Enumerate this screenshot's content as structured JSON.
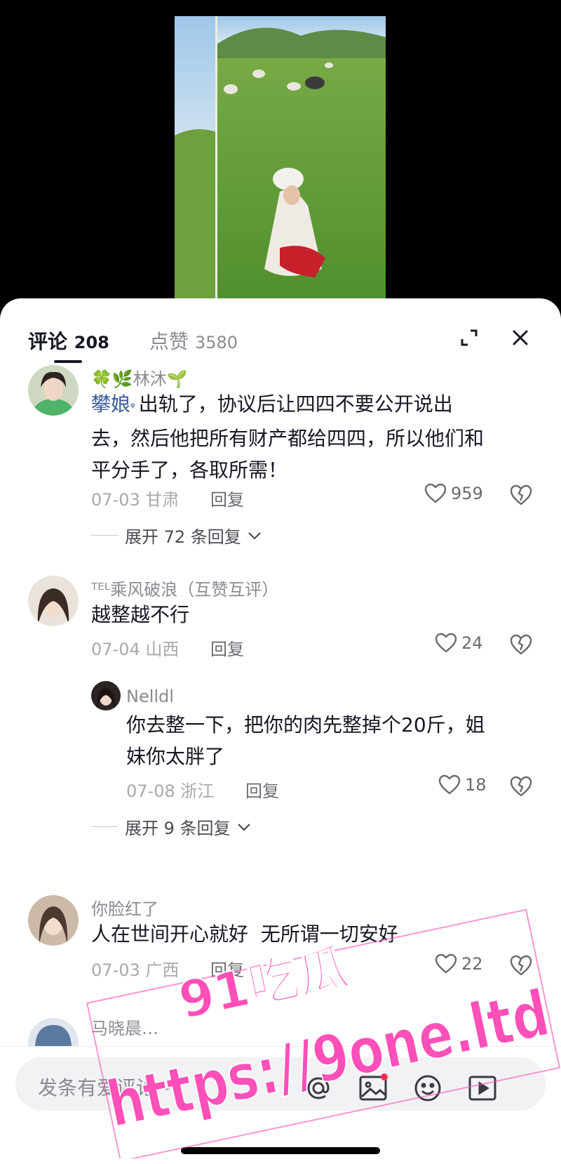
{
  "header": {
    "comments_label": "评论",
    "comments_count": "208",
    "likes_label": "点赞",
    "likes_count": "3580"
  },
  "comments": [
    {
      "username": "🍀🌿林沐🌱",
      "mention": "攀娘",
      "text_line1": "出轨了，协议后让四四不要公开说出",
      "text_line2": "去，然后他把所有财产都给四四，所以他们和",
      "text_line3": "平分手了，各取所需！",
      "date": "07-03",
      "location": "甘肃",
      "reply_label": "回复",
      "likes": "959",
      "expand_label": "展开 72 条回复"
    },
    {
      "username": "ᵀᴱᴸ乘风破浪（互赞互评）",
      "text": "越整越不行",
      "date": "07-04",
      "location": "山西",
      "reply_label": "回复",
      "likes": "24",
      "reply": {
        "username": "Nelldl",
        "text_line1": "你去整一下，把你的肉先整掉个20斤，姐",
        "text_line2": "妹你太胖了",
        "date": "07-08",
        "location": "浙江",
        "reply_label": "回复",
        "likes": "18"
      },
      "expand_label": "展开 9 条回复"
    },
    {
      "username": "你脸红了",
      "text": "人在世间开心就好  无所谓一切安好",
      "date": "07-03",
      "location": "广西",
      "reply_label": "回复",
      "likes": "22"
    },
    {
      "username": "马晓晨…"
    }
  ],
  "input": {
    "placeholder": "发条有爱评论~"
  },
  "watermark": {
    "line1": "91吃瓜",
    "line2": "https://9one.ltd"
  },
  "colors": {
    "text_primary": "#161823",
    "text_secondary": "#8a8b91",
    "mention": "#3c5a9a",
    "watermark": "#ff4fb8",
    "notification_dot": "#fe2c55"
  },
  "icons": [
    "expand-icon",
    "close-icon",
    "heart-icon",
    "dislike-icon",
    "chevron-down-icon",
    "at-icon",
    "image-icon",
    "emoji-icon",
    "play-icon"
  ]
}
